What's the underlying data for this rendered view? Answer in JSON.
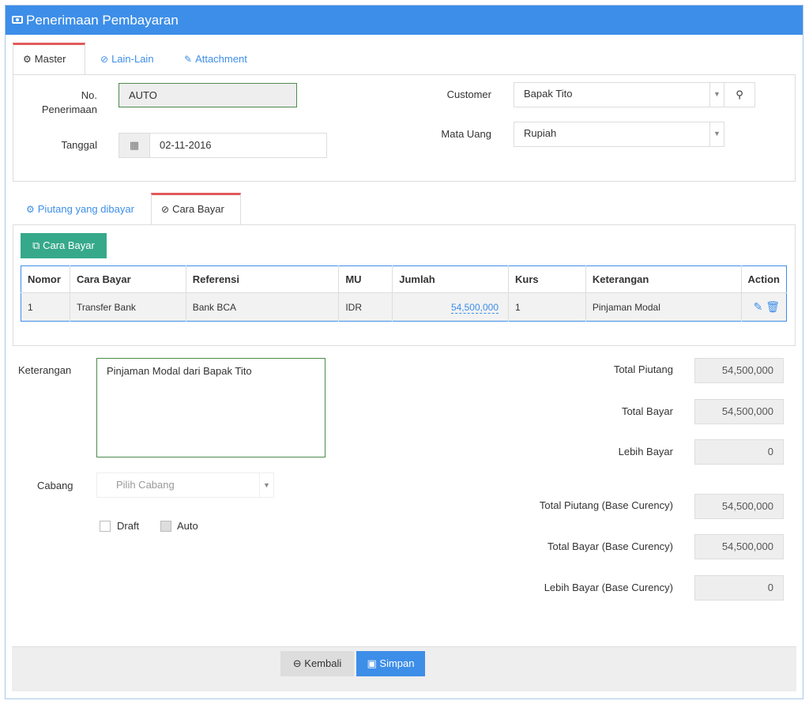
{
  "header": {
    "title": "Penerimaan Pembayaran"
  },
  "tabs_top": [
    {
      "label": "Master",
      "icon": "gears-icon"
    },
    {
      "label": "Lain-Lain",
      "icon": "check-circle-icon"
    },
    {
      "label": "Attachment",
      "icon": "paperclip-icon"
    }
  ],
  "master": {
    "no_label": "No. Penerimaan",
    "no_value": "AUTO",
    "tanggal_label": "Tanggal",
    "tanggal_value": "02-11-2016",
    "customer_label": "Customer",
    "customer_value": "Bapak Tito",
    "mata_uang_label": "Mata Uang",
    "mata_uang_value": "Rupiah"
  },
  "tabs_bottom": [
    {
      "label": "Piutang yang dibayar",
      "icon": "gears-icon"
    },
    {
      "label": "Cara Bayar",
      "icon": "check-circle-icon"
    }
  ],
  "cara_bayar": {
    "add_button": "Cara Bayar",
    "columns": [
      "Nomor",
      "Cara Bayar",
      "Referensi",
      "MU",
      "Jumlah",
      "Kurs",
      "Keterangan",
      "Action"
    ],
    "rows": [
      {
        "nomor": "1",
        "cara": "Transfer Bank",
        "referensi": "Bank BCA",
        "mu": "IDR",
        "jumlah": "54,500,000",
        "kurs": "1",
        "keterangan": "Pinjaman Modal"
      }
    ]
  },
  "form": {
    "keterangan_label": "Keterangan",
    "keterangan_value": "Pinjaman Modal dari Bapak Tito",
    "cabang_label": "Cabang",
    "cabang_placeholder": "Pilih Cabang",
    "draft_label": "Draft",
    "auto_label": "Auto"
  },
  "totals": [
    {
      "label": "Total Piutang",
      "value": "54,500,000"
    },
    {
      "label": "Total Bayar",
      "value": "54,500,000"
    },
    {
      "label": "Lebih Bayar",
      "value": "0"
    },
    {
      "label": "Total Piutang (Base Curency)",
      "value": "54,500,000"
    },
    {
      "label": "Total Bayar (Base Curency)",
      "value": "54,500,000"
    },
    {
      "label": "Lebih Bayar (Base Curency)",
      "value": "0"
    }
  ],
  "footer": {
    "back_label": "Kembali",
    "save_label": "Simpan"
  },
  "colors": {
    "header": "#3d8ee8",
    "tab_active": "#e35a5a",
    "btn_green": "#36a98b",
    "btn_save": "#3d8ee8"
  }
}
